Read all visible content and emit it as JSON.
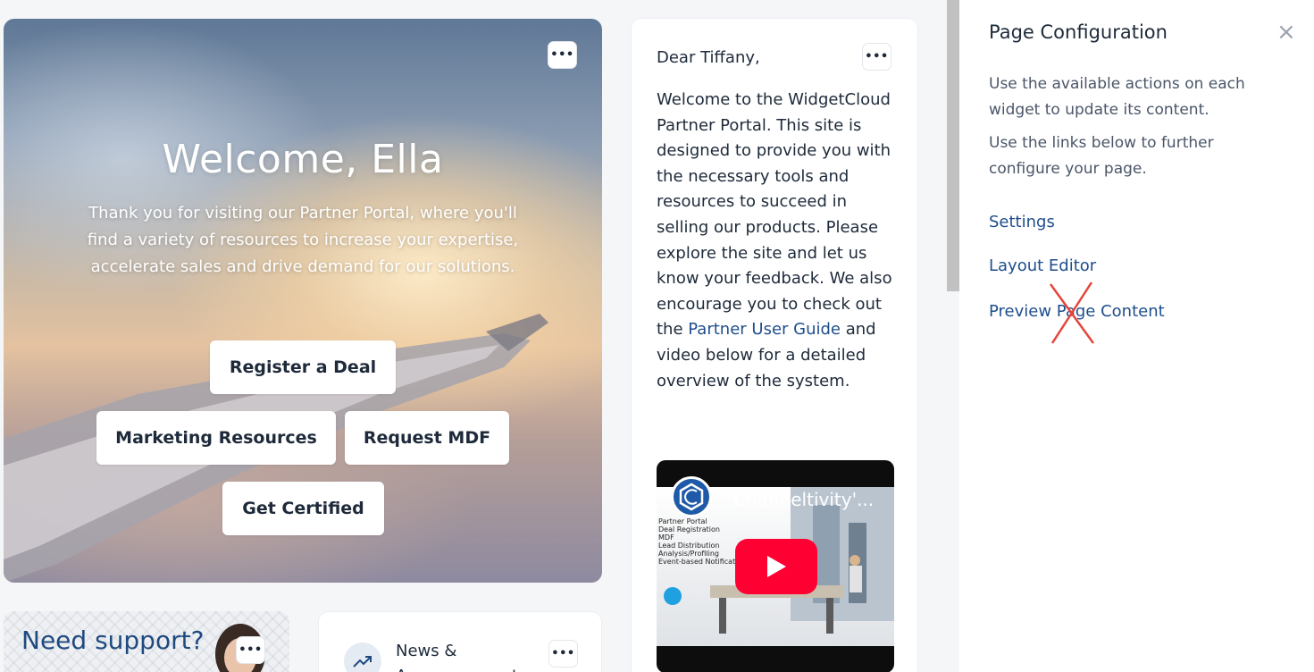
{
  "hero": {
    "title": "Welcome, Ella",
    "text": "Thank you for visiting our Partner Portal, where you'll find a variety of resources to increase your expertise, accelerate sales and drive demand for our solutions.",
    "buttons": {
      "register": "Register a Deal",
      "marketing": "Marketing Resources",
      "mdf": "Request MDF",
      "certified": "Get Certified"
    },
    "menu_glyph": "•••"
  },
  "letter": {
    "greeting": "Dear Tiffany,",
    "body_before": "Welcome to the WidgetCloud Partner Portal. This site is designed to provide you with the necessary tools and resources to succeed in selling our products. Please explore the site and let us know your feedback. We also encourage you to check out the ",
    "link": "Partner User Guide",
    "body_after": " and video below for a detailed overview of the system.",
    "menu_glyph": "•••",
    "video": {
      "title": "Channeltivity'...",
      "list": [
        "Partner Portal",
        "Deal Registration",
        "MDF",
        "Lead Distribution",
        "Analysis/Profiling",
        "Event-based Notification"
      ]
    }
  },
  "support": {
    "title": "Need support?",
    "menu_glyph": "•••"
  },
  "news": {
    "label_line1": "News &",
    "label_line2": "Announcements",
    "menu_glyph": "•••"
  },
  "panel": {
    "title": "Page Configuration",
    "close_glyph": "×",
    "desc1": "Use the available actions on each widget to update its content.",
    "desc2": "Use the links below to further configure your page.",
    "links": {
      "settings": "Settings",
      "layout": "Layout Editor",
      "preview": "Preview Page Content"
    }
  },
  "colors": {
    "link": "#1f4e8c",
    "annotation_x": "#e5463b",
    "play": "#ff0033"
  }
}
